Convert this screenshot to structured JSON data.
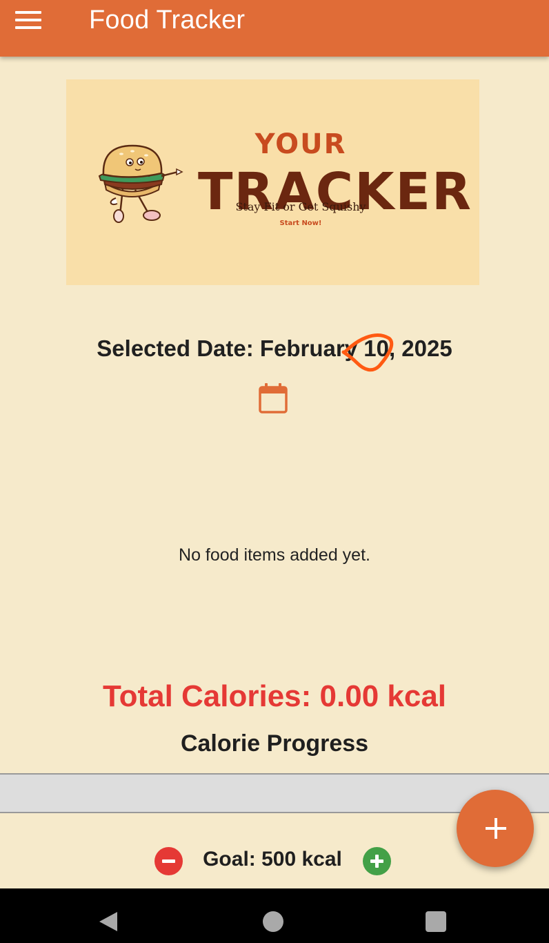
{
  "app_bar": {
    "title": "Food Tracker",
    "menu_icon": "hamburger-menu-icon",
    "background_color": "#E06C37"
  },
  "banner": {
    "line1": "YOUR",
    "line2": "TRACKER",
    "tagline": "Stay Fit or Get Squishy",
    "cta": "Start Now!",
    "mascot": "burger-mascot-illustration"
  },
  "date_section": {
    "label": "Selected Date: February 10, 2025",
    "calendar_icon": "calendar-icon"
  },
  "food_list": {
    "empty_message": "No food items added yet."
  },
  "calories": {
    "total_label": "Total Calories: 0.00 kcal",
    "progress_title": "Calorie Progress",
    "progress_fraction": 0,
    "total_color": "#E53935"
  },
  "goal": {
    "label": "Goal: 500 kcal",
    "decrease_icon": "minus-circle-icon",
    "increase_icon": "plus-circle-icon"
  },
  "fab": {
    "icon": "plus-icon"
  },
  "system_nav": {
    "back_icon": "back-triangle-icon",
    "home_icon": "home-circle-icon",
    "recents_icon": "recents-square-icon"
  }
}
